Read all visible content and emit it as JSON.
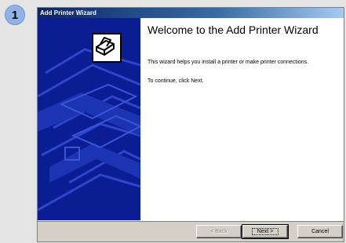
{
  "step_badge": "1",
  "window": {
    "title": "Add Printer Wizard"
  },
  "content": {
    "title": "Welcome to the Add Printer Wizard",
    "description": "This wizard helps you install a printer or make printer connections.",
    "instruction": "To continue, click Next."
  },
  "buttons": {
    "back": "< Back",
    "next": "Next >",
    "cancel": "Cancel"
  },
  "icons": {
    "wizard_graphic": "printer-icon"
  },
  "colors": {
    "side_panel": "#0a1d92",
    "titlebar_start": "#0a246a",
    "titlebar_end": "#a6caf0",
    "badge": "#8fb3e6"
  }
}
